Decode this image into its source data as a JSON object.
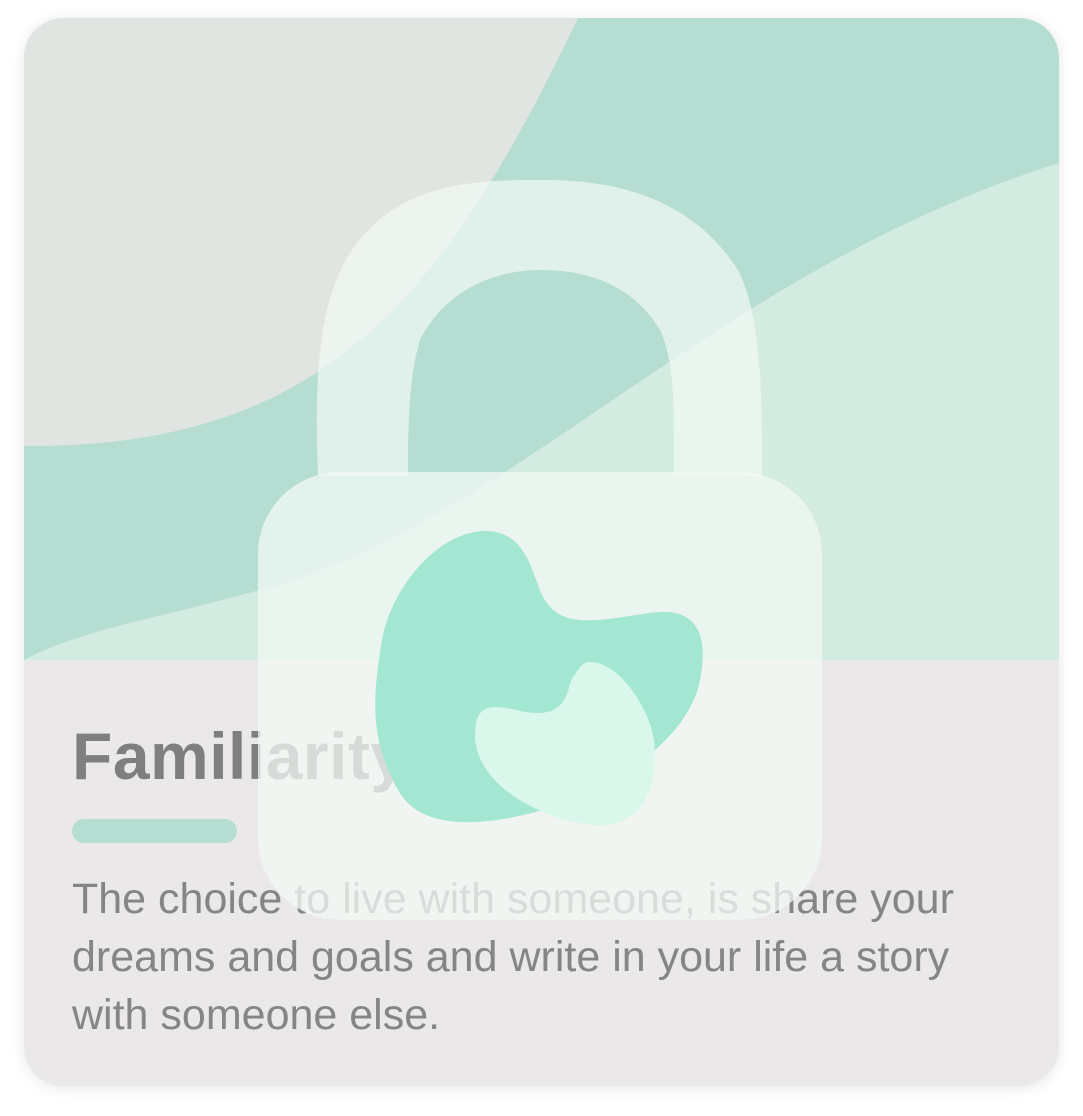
{
  "card": {
    "title": "Familiarity",
    "description": "The choice to live with someone, is share your dreams and goals and write in your life a story with someone else."
  },
  "icons": {
    "overlay": "lock-icon",
    "header": "abstract-wave-illustration"
  },
  "colors": {
    "card_background": "#eae8e9",
    "header_grey": "#e1e5e1",
    "header_teal": "#b5ddd2",
    "header_light_teal": "#d3ebe0",
    "accent": "#b5ddd2",
    "title_text": "#7f7f7f",
    "body_text": "#858585",
    "lock_fill": "#f2f9f5",
    "blob_primary": "#a3e6d2",
    "blob_secondary": "#d9f7ea"
  }
}
